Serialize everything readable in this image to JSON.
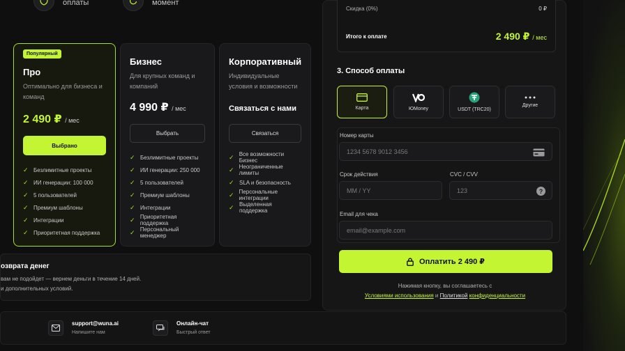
{
  "top_features": [
    {
      "label": "оплаты",
      "icon": "shield-icon"
    },
    {
      "label": "момент",
      "icon": "refresh-icon"
    }
  ],
  "plans": [
    {
      "badge": "Популярный",
      "name": "Про",
      "desc": "Оптимально для бизнеса и команд",
      "price": "2 490 ₽",
      "per": "/ мес",
      "button": "Выбрано",
      "features": [
        "Безлимитные проекты",
        "ИИ генерации: 100 000",
        "5 пользователей",
        "Премиум шаблоны",
        "Интеграции",
        "Приоритетная поддержка"
      ]
    },
    {
      "name": "Бизнес",
      "desc": "Для крупных команд и компаний",
      "price": "4 990 ₽",
      "per": "/ мес",
      "button": "Выбрать",
      "features": [
        "Безлимитные проекты",
        "ИИ генерации: 250 000",
        "5 пользователей",
        "Премиум шаблоны",
        "Интеграции",
        "Приоритетная поддержка",
        "Персональный менеджер"
      ]
    },
    {
      "name": "Корпоративный",
      "desc": "Индивидуальные условия и возможности",
      "contact": "Связаться с нами",
      "button": "Связаться",
      "features": [
        "Все возможности Бизнес",
        "Неограниченные лимиты",
        "SLA и безопасность",
        "Персональные интеграции",
        "Выделенная поддержка"
      ]
    }
  ],
  "refund": {
    "title": "озврата денег",
    "line1": "вам не подойдет — вернем деньги в течение 14 дней.",
    "line2": "и дополнительных условий."
  },
  "footer": {
    "email": "support@wuna.ai",
    "email_sub": "Напишите нам",
    "chat": "Онлайн-чат",
    "chat_sub": "Быстрый ответ"
  },
  "summary": {
    "discount_label": "Скидка (0%)",
    "discount_value": "0 ₽",
    "total_label": "Итого к оплате",
    "total_value": "2 490 ₽",
    "total_per": "/ мес"
  },
  "payment": {
    "title": "3. Способ оплаты",
    "methods": [
      {
        "label": "Карта",
        "icon": "card-icon"
      },
      {
        "label": "ЮMoney",
        "icon": "yoomoney-icon"
      },
      {
        "label": "USDT (TRC20)",
        "icon": "tether-icon"
      },
      {
        "label": "Другие",
        "icon": "more-icon"
      }
    ],
    "card_number_label": "Номер карты",
    "card_number_placeholder": "1234 5678 9012 3456",
    "expiry_label": "Срок действия",
    "expiry_placeholder": "MM / YY",
    "cvc_label": "CVC / CVV",
    "cvc_placeholder": "123",
    "email_label": "Email для чека",
    "email_placeholder": "email@example.com",
    "pay_button": "Оплатить 2 490 ₽",
    "terms_line": "Нажимая кнопку, вы соглашаетесь с",
    "terms_link": "Условиями использования",
    "terms_and": "и",
    "privacy_link1": "Политикой",
    "privacy_link2": "конфиденциальности"
  },
  "colors": {
    "accent": "#c4f532",
    "background": "#0f0f10"
  }
}
